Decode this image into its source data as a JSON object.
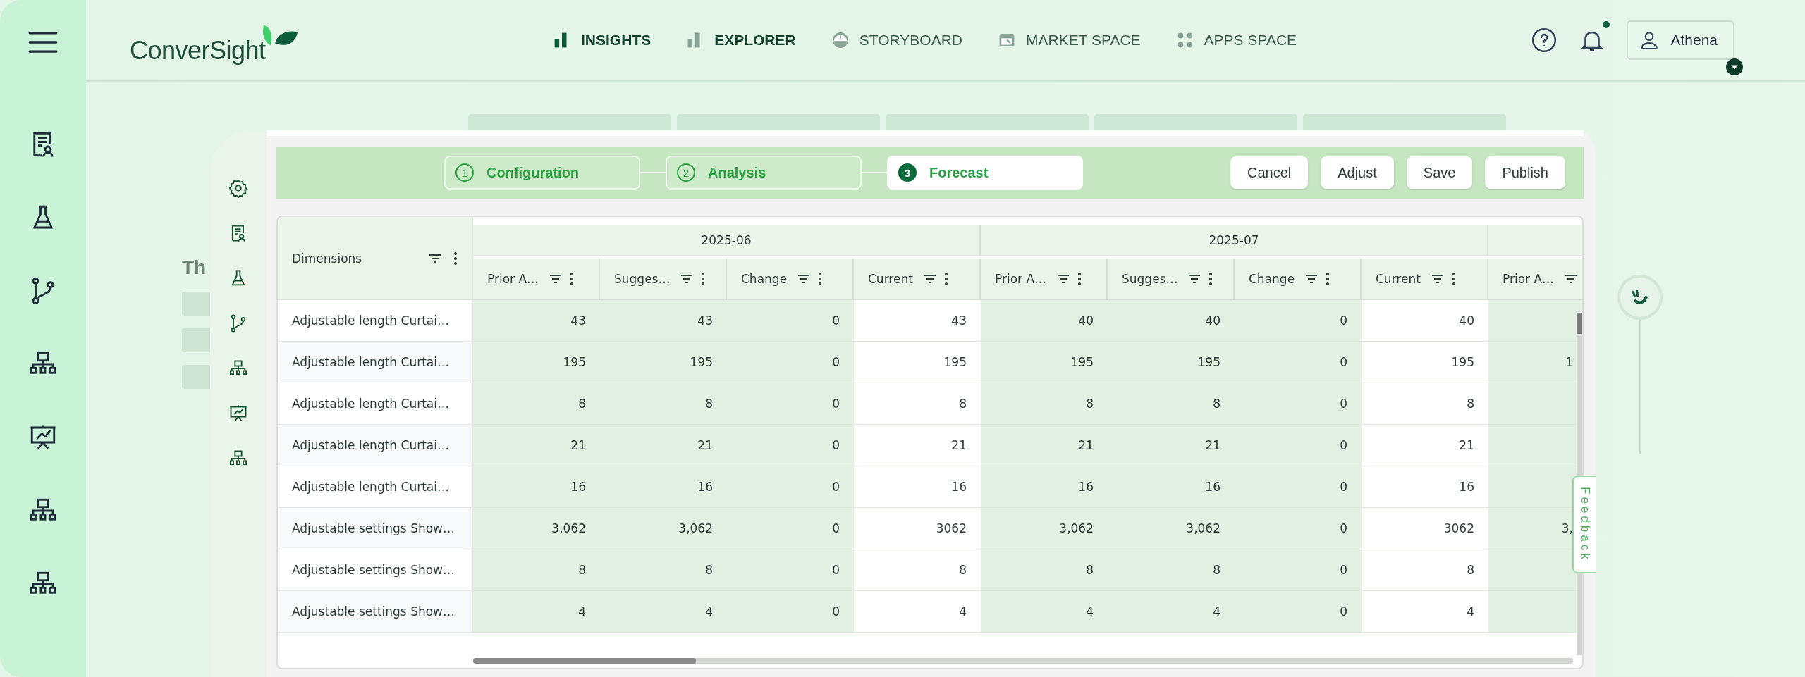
{
  "topbar": {
    "logo": "ConverSight",
    "nav": [
      {
        "label": "INSIGHTS",
        "kind": "insights",
        "emphasized": true
      },
      {
        "label": "EXPLORER",
        "kind": "explorer",
        "emphasized": true
      },
      {
        "label": "STORYBOARD",
        "kind": "storyboard",
        "emphasized": false
      },
      {
        "label": "MARKET SPACE",
        "kind": "market",
        "emphasized": false
      },
      {
        "label": "APPS SPACE",
        "kind": "apps",
        "emphasized": false
      }
    ],
    "notification": true,
    "user": "Athena"
  },
  "background": {
    "heading": "Th"
  },
  "steps": [
    {
      "number": "1",
      "label": "Configuration",
      "selected": false
    },
    {
      "number": "2",
      "label": "Analysis",
      "selected": false
    },
    {
      "number": "3",
      "label": "Forecast",
      "selected": true
    }
  ],
  "actions": [
    "Cancel",
    "Adjust",
    "Save",
    "Publish"
  ],
  "table": {
    "dimension_header": "Dimensions",
    "groups": [
      {
        "label": "2025-06",
        "columns": [
          {
            "label": "Prior A…",
            "highlighted": false
          },
          {
            "label": "Sugges…",
            "highlighted": false
          },
          {
            "label": "Change",
            "highlighted": false
          },
          {
            "label": "Current",
            "highlighted": true
          }
        ]
      },
      {
        "label": "2025-07",
        "columns": [
          {
            "label": "Prior A…",
            "highlighted": false
          },
          {
            "label": "Sugges…",
            "highlighted": false
          },
          {
            "label": "Change",
            "highlighted": false
          },
          {
            "label": "Current",
            "highlighted": true
          }
        ]
      },
      {
        "columns": [
          {
            "label": "Prior A…",
            "highlighted": false
          }
        ]
      }
    ],
    "rows": [
      {
        "dimension": "Adjustable length Curtai…",
        "cells": [
          "43",
          "43",
          "0",
          "43",
          "40",
          "40",
          "0",
          "40"
        ]
      },
      {
        "dimension": "Adjustable length Curtai…",
        "cells": [
          "195",
          "195",
          "0",
          "195",
          "195",
          "195",
          "0",
          "195",
          "1"
        ]
      },
      {
        "dimension": "Adjustable length Curtai…",
        "cells": [
          "8",
          "8",
          "0",
          "8",
          "8",
          "8",
          "0",
          "8"
        ]
      },
      {
        "dimension": "Adjustable length Curtai…",
        "cells": [
          "21",
          "21",
          "0",
          "21",
          "21",
          "21",
          "0",
          "21"
        ]
      },
      {
        "dimension": "Adjustable length Curtai…",
        "cells": [
          "16",
          "16",
          "0",
          "16",
          "16",
          "16",
          "0",
          "16"
        ]
      },
      {
        "dimension": "Adjustable settings Show…",
        "cells": [
          "3,062",
          "3,062",
          "0",
          "3062",
          "3,062",
          "3,062",
          "0",
          "3062",
          "3,"
        ]
      },
      {
        "dimension": "Adjustable settings Show…",
        "cells": [
          "8",
          "8",
          "0",
          "8",
          "8",
          "8",
          "0",
          "8"
        ]
      },
      {
        "dimension": "Adjustable settings Show…",
        "cells": [
          "4",
          "4",
          "0",
          "4",
          "4",
          "4",
          "0",
          "4"
        ]
      }
    ]
  },
  "feedback": "Feedback"
}
